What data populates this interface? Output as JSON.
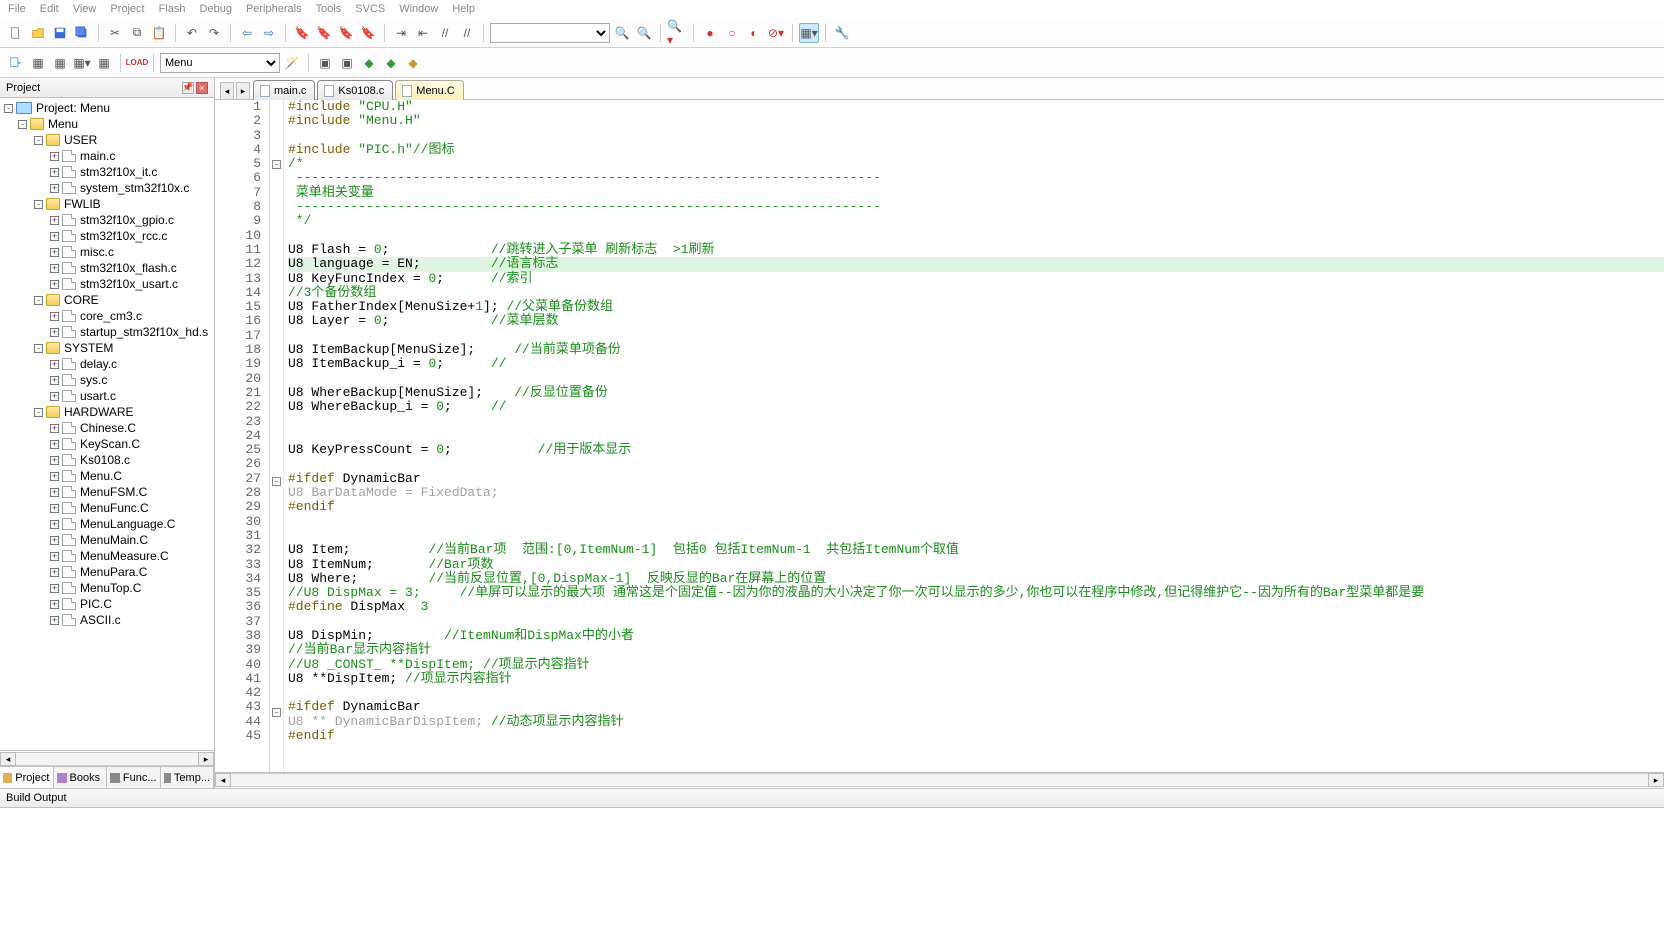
{
  "menubar": [
    "File",
    "Edit",
    "View",
    "Project",
    "Flash",
    "Debug",
    "Peripherals",
    "Tools",
    "SVCS",
    "Window",
    "Help"
  ],
  "toolbar2_combo": "Menu",
  "panel": {
    "title": "Project"
  },
  "bottom_tabs": [
    "Project",
    "Books",
    "Func...",
    "Temp..."
  ],
  "output": {
    "title": "Build Output"
  },
  "tree": {
    "root": "Project: Menu",
    "target": "Menu",
    "groups": [
      {
        "name": "USER",
        "files": [
          "main.c",
          "stm32f10x_it.c",
          "system_stm32f10x.c"
        ]
      },
      {
        "name": "FWLIB",
        "files": [
          "stm32f10x_gpio.c",
          "stm32f10x_rcc.c",
          "misc.c",
          "stm32f10x_flash.c",
          "stm32f10x_usart.c"
        ]
      },
      {
        "name": "CORE",
        "files": [
          "core_cm3.c",
          "startup_stm32f10x_hd.s"
        ]
      },
      {
        "name": "SYSTEM",
        "files": [
          "delay.c",
          "sys.c",
          "usart.c"
        ]
      },
      {
        "name": "HARDWARE",
        "files": [
          "Chinese.C",
          "KeyScan.C",
          "Ks0108.c",
          "Menu.C",
          "MenuFSM.C",
          "MenuFunc.C",
          "MenuLanguage.C",
          "MenuMain.C",
          "MenuMeasure.C",
          "MenuPara.C",
          "MenuTop.C",
          "PIC.C",
          "ASCII.c"
        ]
      }
    ]
  },
  "editor_tabs": [
    {
      "label": "main.c",
      "active": false
    },
    {
      "label": "Ks0108.c",
      "active": false
    },
    {
      "label": "Menu.C",
      "active": true
    }
  ],
  "code_lines": [
    {
      "n": 1,
      "fold": "",
      "html": "<span class='pp'>#include</span> <span class='str'>\"CPU.H\"</span>"
    },
    {
      "n": 2,
      "fold": "",
      "html": "<span class='pp'>#include</span> <span class='str'>\"Menu.H\"</span>"
    },
    {
      "n": 3,
      "fold": "",
      "html": ""
    },
    {
      "n": 4,
      "fold": "",
      "html": "<span class='pp'>#include</span> <span class='str'>\"PIC.h\"</span><span class='cm'>//图标</span>"
    },
    {
      "n": 5,
      "fold": "-",
      "html": "<span class='cm'>/*</span>"
    },
    {
      "n": 6,
      "fold": "",
      "html": "<span class='cm'> ---------------------------------------------------------------------------</span>"
    },
    {
      "n": 7,
      "fold": "",
      "html": "<span class='cm'> 菜单相关变量</span>"
    },
    {
      "n": 8,
      "fold": "",
      "html": "<span class='cm'> ---------------------------------------------------------------------------</span>"
    },
    {
      "n": 9,
      "fold": "",
      "html": "<span class='cm'> */</span>"
    },
    {
      "n": 10,
      "fold": "",
      "html": ""
    },
    {
      "n": 11,
      "fold": "",
      "html": "U8 Flash = <span class='num'>0</span>;             <span class='cm'>//跳转进入子菜单 刷新标志  &gt;1刷新</span>"
    },
    {
      "n": 12,
      "fold": "",
      "hl": true,
      "html": "U8 language = EN;         <span class='cm'>//语言标志</span>"
    },
    {
      "n": 13,
      "fold": "",
      "html": "U8 KeyFuncIndex = <span class='num'>0</span>;      <span class='cm'>//索引</span>"
    },
    {
      "n": 14,
      "fold": "",
      "html": "<span class='cm'>//3个备份数组</span>"
    },
    {
      "n": 15,
      "fold": "",
      "html": "U8 FatherIndex[MenuSize+<span class='num'>1</span>]; <span class='cm'>//父菜单备份数组</span>"
    },
    {
      "n": 16,
      "fold": "",
      "html": "U8 Layer = <span class='num'>0</span>;             <span class='cm'>//菜单层数</span>"
    },
    {
      "n": 17,
      "fold": "",
      "html": ""
    },
    {
      "n": 18,
      "fold": "",
      "html": "U8 ItemBackup[MenuSize];     <span class='cm'>//当前菜单项备份</span>"
    },
    {
      "n": 19,
      "fold": "",
      "html": "U8 ItemBackup_i = <span class='num'>0</span>;      <span class='cm'>//</span>"
    },
    {
      "n": 20,
      "fold": "",
      "html": ""
    },
    {
      "n": 21,
      "fold": "",
      "html": "U8 WhereBackup[MenuSize];    <span class='cm'>//反显位置备份</span>"
    },
    {
      "n": 22,
      "fold": "",
      "html": "U8 WhereBackup_i = <span class='num'>0</span>;     <span class='cm'>//</span>"
    },
    {
      "n": 23,
      "fold": "",
      "html": ""
    },
    {
      "n": 24,
      "fold": "",
      "html": ""
    },
    {
      "n": 25,
      "fold": "",
      "html": "U8 KeyPressCount = <span class='num'>0</span>;           <span class='cm'>//用于版本显示</span>"
    },
    {
      "n": 26,
      "fold": "",
      "html": ""
    },
    {
      "n": 27,
      "fold": "-",
      "html": "<span class='pp'>#ifdef</span> DynamicBar"
    },
    {
      "n": 28,
      "fold": "",
      "html": "<span class='dim'>U8 BarDataMode = FixedData;</span>"
    },
    {
      "n": 29,
      "fold": "",
      "html": "<span class='pp'>#endif</span>"
    },
    {
      "n": 30,
      "fold": "",
      "html": ""
    },
    {
      "n": 31,
      "fold": "",
      "html": ""
    },
    {
      "n": 32,
      "fold": "",
      "html": "U8 Item;          <span class='cm'>//当前Bar项  范围:[0,ItemNum-1]  包括0 包括ItemNum-1  共包括ItemNum个取值</span>"
    },
    {
      "n": 33,
      "fold": "",
      "html": "U8 ItemNum;       <span class='cm'>//Bar项数</span>"
    },
    {
      "n": 34,
      "fold": "",
      "html": "U8 Where;         <span class='cm'>//当前反显位置,[0,DispMax-1]  反映反显的Bar在屏幕上的位置</span>"
    },
    {
      "n": 35,
      "fold": "",
      "html": "<span class='cm'>//U8 DispMax = 3;     //单屏可以显示的最大项 通常这是个固定值--因为你的液晶的大小决定了你一次可以显示的多少,你也可以在程序中修改,但记得维护它--因为所有的Bar型菜单都是要</span>"
    },
    {
      "n": 36,
      "fold": "",
      "html": "<span class='pp'>#define</span> DispMax  <span class='num'>3</span>"
    },
    {
      "n": 37,
      "fold": "",
      "html": ""
    },
    {
      "n": 38,
      "fold": "",
      "html": "U8 DispMin;         <span class='cm'>//ItemNum和DispMax中的小者</span>"
    },
    {
      "n": 39,
      "fold": "",
      "html": "<span class='cm'>//当前Bar显示内容指针</span>"
    },
    {
      "n": 40,
      "fold": "",
      "html": "<span class='cm'>//U8 _CONST_ **DispItem; //项显示内容指针</span>"
    },
    {
      "n": 41,
      "fold": "",
      "html": "U8 **DispItem; <span class='cm'>//项显示内容指针</span>"
    },
    {
      "n": 42,
      "fold": "",
      "html": ""
    },
    {
      "n": 43,
      "fold": "-",
      "html": "<span class='pp'>#ifdef</span> DynamicBar"
    },
    {
      "n": 44,
      "fold": "",
      "html": "<span class='dim'>U8 ** DynamicBarDispItem; </span><span class='cm'>//动态项显示内容指针</span>"
    },
    {
      "n": 45,
      "fold": "",
      "html": "<span class='pp'>#endif</span>"
    }
  ],
  "chart_data": null
}
